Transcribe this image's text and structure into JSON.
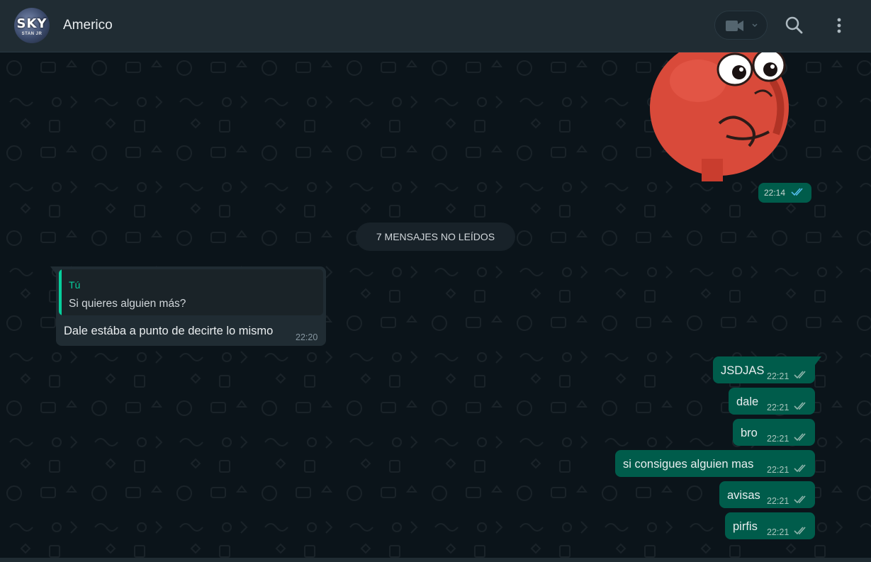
{
  "header": {
    "avatar_text": "SKY",
    "avatar_sub": "STAN JR",
    "contact_name": "Americo",
    "icons": [
      "video-call-icon",
      "chevron-down-icon",
      "search-icon",
      "menu-dots-icon"
    ]
  },
  "sticker": {
    "time": "22:14",
    "status": "read"
  },
  "unread_banner": "7 MENSAJES NO LEÍDOS",
  "incoming": {
    "quote_author": "Tú",
    "quote_text": "Si quieres alguien más?",
    "text": "Dale estába a punto de decirte lo mismo",
    "time": "22:20"
  },
  "outgoing": [
    {
      "text": "JSDJAS",
      "time": "22:21"
    },
    {
      "text": "dale",
      "time": "22:21"
    },
    {
      "text": "bro",
      "time": "22:21"
    },
    {
      "text": "si consigues alguien mas",
      "time": "22:21"
    },
    {
      "text": "avisas",
      "time": "22:21"
    },
    {
      "text": "pirfis",
      "time": "22:21"
    }
  ],
  "colors": {
    "header_bg": "#202c33",
    "chat_bg": "#0b141a",
    "outgoing_bubble": "#005c4b",
    "incoming_bubble": "#202c33",
    "accent": "#06cf9c",
    "read_ticks": "#53bdeb"
  }
}
